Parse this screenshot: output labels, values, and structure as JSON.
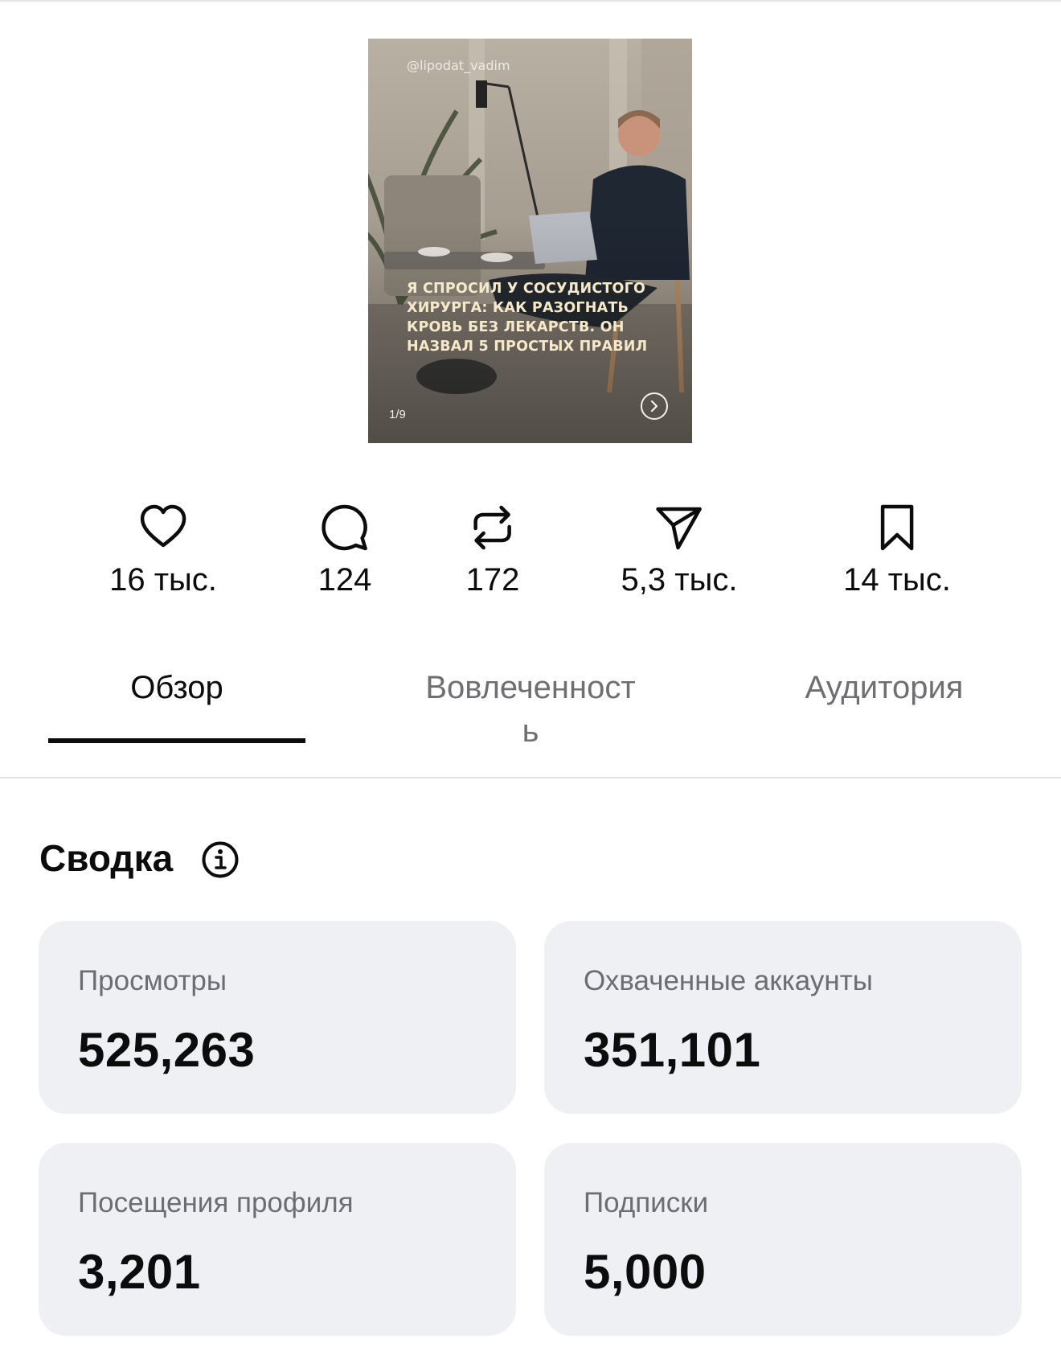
{
  "post": {
    "handle": "@lipodat_vadim",
    "caption": "Я спросил у сосудистого хирурга: как разогнать кровь без лекарств. Он назвал 5 простых правил",
    "slide_counter": "1/9"
  },
  "actions": [
    {
      "icon": "heart-icon",
      "value": "16 тыс."
    },
    {
      "icon": "comment-icon",
      "value": "124"
    },
    {
      "icon": "repost-icon",
      "value": "172"
    },
    {
      "icon": "share-icon",
      "value": "5,3 тыс."
    },
    {
      "icon": "bookmark-icon",
      "value": "14 тыс."
    }
  ],
  "tabs": [
    {
      "label": "Обзор",
      "active": true
    },
    {
      "label": "Вовлеченност\nь",
      "active": false
    },
    {
      "label": "Аудитория",
      "active": false
    }
  ],
  "summary": {
    "title": "Сводка",
    "cards": [
      {
        "label": "Просмотры",
        "value": "525,263"
      },
      {
        "label": "Охваченные аккаунты",
        "value": "351,101"
      },
      {
        "label": "Посещения профиля",
        "value": "3,201"
      },
      {
        "label": "Подписки",
        "value": "5,000"
      }
    ]
  },
  "colors": {
    "text": "#0c0c0c",
    "muted_text": "#6c6d72",
    "card_background": "#eff0f4",
    "caption": "#f6e9c9"
  }
}
